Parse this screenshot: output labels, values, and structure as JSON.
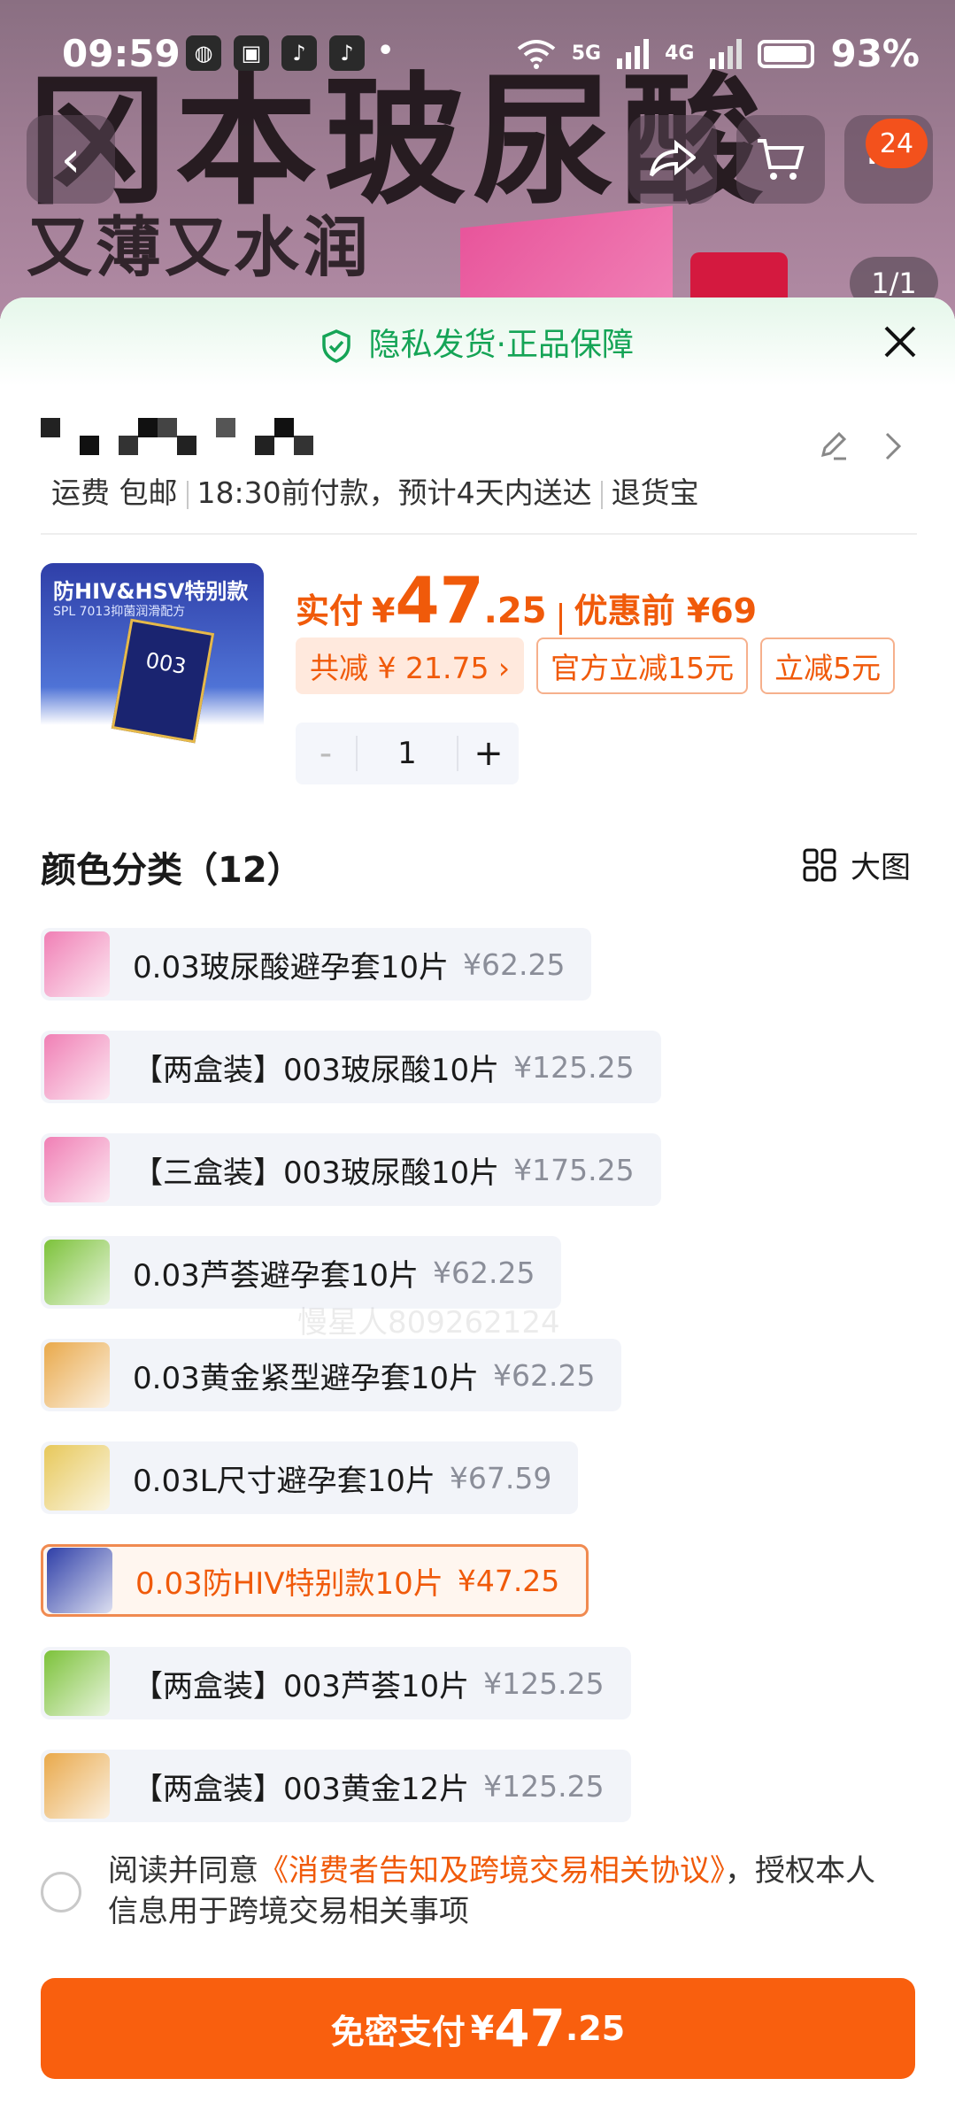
{
  "status_bar": {
    "time": "09:59",
    "net1": "5G",
    "net2": "4G",
    "battery": "93%"
  },
  "banner": {
    "title": "冈本玻尿酸",
    "subtitle": "又薄又水润",
    "cart_count": "24",
    "page_indicator": "1/1"
  },
  "sheet": {
    "guarantee": "隐私发货·正品保障"
  },
  "shipping": {
    "fee": "运费 包邮",
    "delivery": "18:30前付款，预计4天内送达",
    "returns": "退货宝"
  },
  "product": {
    "thumb_title": "防HIV&HSV特别款",
    "thumb_sub": "SPL 7013抑菌润滑配方",
    "thumb_box": "003",
    "price_label": "实付",
    "currency": "¥",
    "price_int": "47",
    "price_dec": ".25",
    "before_label": "优惠前 ¥69",
    "chips": [
      "共减 ¥ 21.75 ›",
      "官方立减15元",
      "立减5元"
    ],
    "quantity": "1"
  },
  "variants": {
    "title": "颜色分类（12）",
    "big_image_label": "大图",
    "items": [
      {
        "name": "0.03玻尿酸避孕套10片",
        "price": "¥62.25",
        "color": "#f07fb5",
        "selected": false
      },
      {
        "name": "【两盒装】003玻尿酸10片",
        "price": "¥125.25",
        "color": "#f07fb5",
        "selected": false
      },
      {
        "name": "【三盒装】003玻尿酸10片",
        "price": "¥175.25",
        "color": "#f07fb5",
        "selected": false
      },
      {
        "name": "0.03芦荟避孕套10片",
        "price": "¥62.25",
        "color": "#7cc23a",
        "selected": false
      },
      {
        "name": "0.03黄金紧型避孕套10片",
        "price": "¥62.25",
        "color": "#e9a94b",
        "selected": false
      },
      {
        "name": "0.03L尺寸避孕套10片",
        "price": "¥67.59",
        "color": "#e7c85a",
        "selected": false
      },
      {
        "name": "0.03防HIV特别款10片",
        "price": "¥47.25",
        "color": "#2f3fa8",
        "selected": true
      },
      {
        "name": "【两盒装】003芦荟10片",
        "price": "¥125.25",
        "color": "#7cc23a",
        "selected": false
      },
      {
        "name": "【两盒装】003黄金12片",
        "price": "¥125.25",
        "color": "#e9a94b",
        "selected": false
      }
    ]
  },
  "watermark": "慢星人809262124",
  "agreement": {
    "prefix": "阅读并同意",
    "link": "《消费者告知及跨境交易相关协议》",
    "suffix": "，授权本人信息用于跨境交易相关事项"
  },
  "pay": {
    "label": "免密支付",
    "currency": "¥",
    "int": "47",
    "dec": ".25"
  },
  "colors": {
    "accent": "#f95f0e",
    "guarantee_green": "#15a456"
  }
}
